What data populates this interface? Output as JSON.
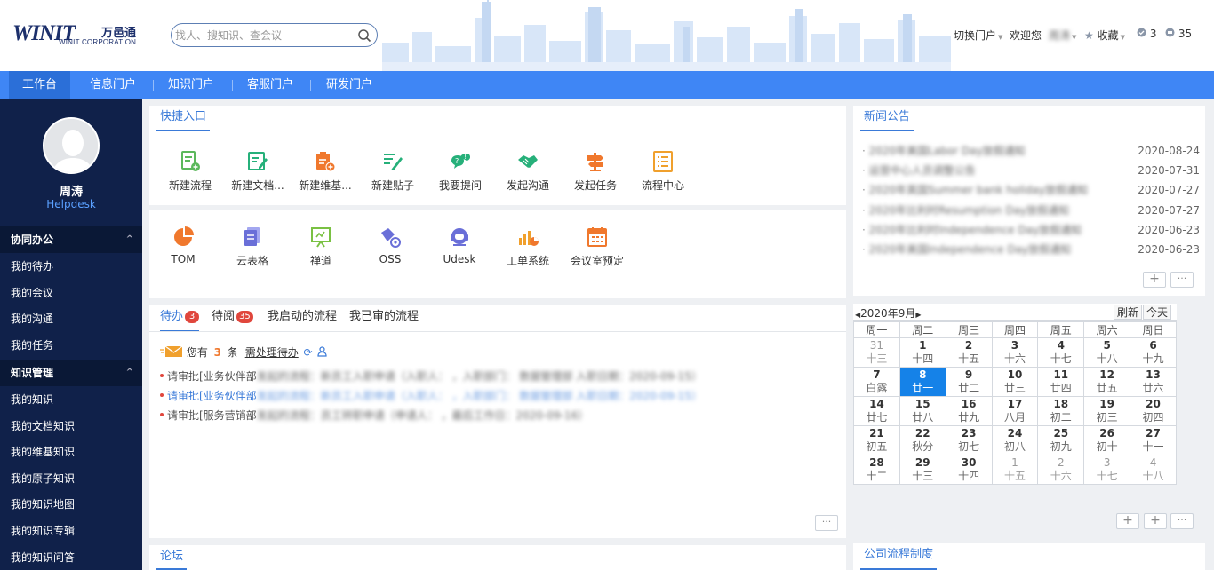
{
  "brand": {
    "mark": "WINIT",
    "cn": "万邑通",
    "en": "WINIT CORPORATION"
  },
  "search": {
    "placeholder": "找人、搜知识、查会议"
  },
  "header": {
    "portal_switch": "切换门户",
    "welcome": "欢迎您",
    "user_short": "周涛",
    "favorites": "收藏",
    "count_a": "3",
    "count_b": "35"
  },
  "nav": [
    "工作台",
    "信息门户",
    "知识门户",
    "客服门户",
    "研发门户"
  ],
  "user": {
    "name": "周涛",
    "role": "Helpdesk"
  },
  "sidebar": {
    "sections": [
      {
        "title": "协同办公",
        "items": [
          "我的待办",
          "我的会议",
          "我的沟通",
          "我的任务"
        ]
      },
      {
        "title": "知识管理",
        "items": [
          "我的知识",
          "我的文档知识",
          "我的维基知识",
          "我的原子知识",
          "我的知识地图",
          "我的知识专辑",
          "我的知识问答"
        ]
      }
    ]
  },
  "quick": {
    "title": "快捷入口",
    "row1": [
      "新建流程",
      "新建文档...",
      "新建维基...",
      "新建贴子",
      "我要提问",
      "发起沟通",
      "发起任务",
      "流程中心"
    ],
    "row2": [
      "TOM",
      "云表格",
      "禅道",
      "OSS",
      "Udesk",
      "工单系统",
      "会议室预定"
    ]
  },
  "todo": {
    "tabs": [
      {
        "label": "待办",
        "badge": "3"
      },
      {
        "label": "待阅",
        "badge": "35"
      },
      {
        "label": "我启动的流程"
      },
      {
        "label": "我已审的流程"
      }
    ],
    "summary_pre": "您有",
    "count": "3",
    "summary_mid": "条",
    "summary_link": "需处理待办",
    "rows": [
      {
        "prefix": "请审批[业务伙伴部",
        "rest": "发起的流程：新员工入职申请（入职人：              ，入职部门：      数据管理部 入职日期：2020-09-15）"
      },
      {
        "prefix": "请审批[业务伙伴部",
        "rest": "发起的流程：新员工入职申请（入职人：              ，入职部门：      数据管理部 入职日期：2020-09-15）"
      },
      {
        "prefix": "请审批[服务营销部",
        "rest": "发起的流程：员工转职申请（申请人：            ，最后工作日：2020-09-16）"
      }
    ]
  },
  "forum": {
    "title": "论坛"
  },
  "news": {
    "title": "新闻公告",
    "items": [
      {
        "text": "2020年美国Labor Day放假通知",
        "date": "2020-08-24"
      },
      {
        "text": "运营中心人员调整公告",
        "date": "2020-07-31"
      },
      {
        "text": "2020年英国Summer bank holiday放假通知",
        "date": "2020-07-27"
      },
      {
        "text": "2020年比利时Resumption Day放假通知",
        "date": "2020-07-27"
      },
      {
        "text": "2020年比利时Independence Day放假通知",
        "date": "2020-06-23"
      },
      {
        "text": "2020年美国Independence Day放假通知",
        "date": "2020-06-23"
      }
    ]
  },
  "calendar": {
    "month_label": "2020年9月",
    "refresh": "刷新",
    "today_btn": "今天",
    "weekdays": [
      "周一",
      "周二",
      "周三",
      "周四",
      "周五",
      "周六",
      "周日"
    ],
    "weeks": [
      [
        [
          "31",
          "十三",
          1
        ],
        [
          "1",
          "十四",
          0
        ],
        [
          "2",
          "十五",
          0
        ],
        [
          "3",
          "十六",
          0
        ],
        [
          "4",
          "十七",
          0
        ],
        [
          "5",
          "十八",
          0
        ],
        [
          "6",
          "十九",
          0
        ]
      ],
      [
        [
          "7",
          "白露",
          0
        ],
        [
          "8",
          "廿一",
          2
        ],
        [
          "9",
          "廿二",
          0
        ],
        [
          "10",
          "廿三",
          0
        ],
        [
          "11",
          "廿四",
          0
        ],
        [
          "12",
          "廿五",
          0
        ],
        [
          "13",
          "廿六",
          0
        ]
      ],
      [
        [
          "14",
          "廿七",
          0
        ],
        [
          "15",
          "廿八",
          0
        ],
        [
          "16",
          "廿九",
          0
        ],
        [
          "17",
          "八月",
          0
        ],
        [
          "18",
          "初二",
          0
        ],
        [
          "19",
          "初三",
          0
        ],
        [
          "20",
          "初四",
          0
        ]
      ],
      [
        [
          "21",
          "初五",
          0
        ],
        [
          "22",
          "秋分",
          0
        ],
        [
          "23",
          "初七",
          0
        ],
        [
          "24",
          "初八",
          0
        ],
        [
          "25",
          "初九",
          0
        ],
        [
          "26",
          "初十",
          0
        ],
        [
          "27",
          "十一",
          0
        ]
      ],
      [
        [
          "28",
          "十二",
          0
        ],
        [
          "29",
          "十三",
          0
        ],
        [
          "30",
          "十四",
          0
        ],
        [
          "1",
          "十五",
          1
        ],
        [
          "2",
          "十六",
          1
        ],
        [
          "3",
          "十七",
          1
        ],
        [
          "4",
          "十八",
          1
        ]
      ]
    ]
  },
  "process": {
    "title": "公司流程制度"
  },
  "colors": {
    "primary": "#3f86f5",
    "sidebar": "#10214a",
    "accent": "#3a7ad8",
    "badge": "#e0463c",
    "today": "#1582e8"
  }
}
